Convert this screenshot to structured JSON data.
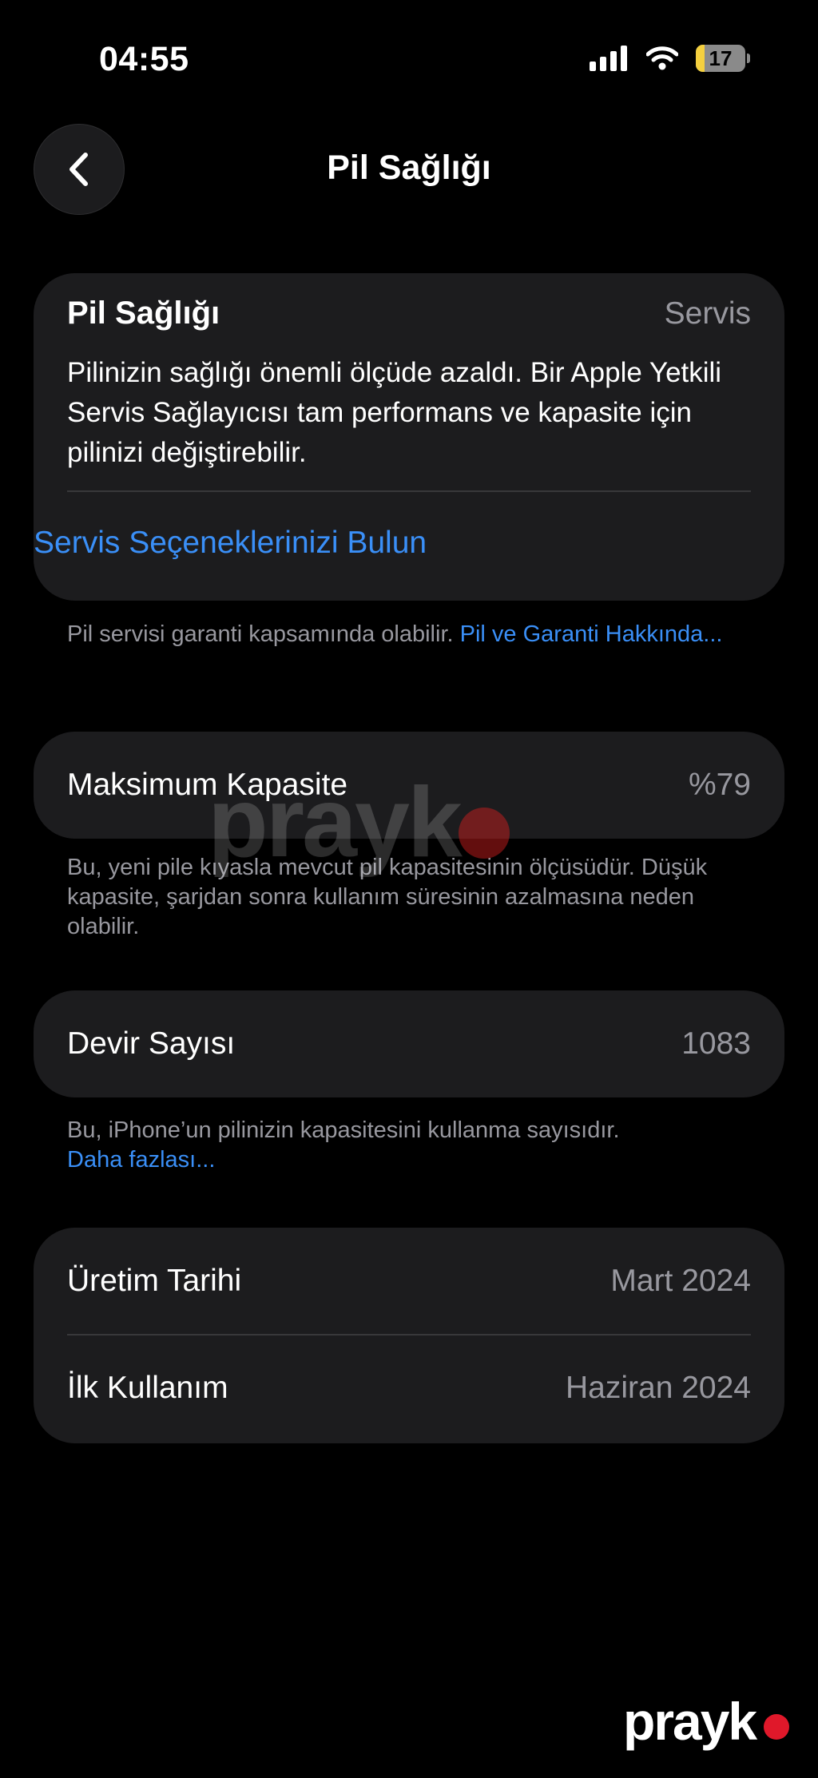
{
  "status_bar": {
    "time": "04:55",
    "battery_level": "17",
    "battery_color": "#f4d03f"
  },
  "nav": {
    "title": "Pil Sağlığı",
    "back_icon": "chevron-left-icon"
  },
  "battery_health": {
    "title": "Pil Sağlığı",
    "status": "Servis",
    "description": "Pilinizin sağlığı önemli ölçüde azaldı. Bir Apple Yetkili Servis Sağlayıcısı tam performans ve kapasite için pilinizi değiştirebilir.",
    "link": "Servis Seçeneklerinizi Bulun",
    "footnote_text": "Pil servisi garanti kapsamında olabilir. ",
    "footnote_link": "Pil ve Garanti Hakkında..."
  },
  "max_capacity": {
    "label": "Maksimum Kapasite",
    "value": "%79",
    "footnote": "Bu, yeni pile kıyasla mevcut pil kapasitesinin ölçüsüdür. Düşük kapasite, şarjdan sonra kullanım süresinin azalmasına neden olabilir."
  },
  "cycle_count": {
    "label": "Devir Sayısı",
    "value": "1083",
    "footnote_text": "Bu, iPhone’un pilinizin kapasitesini kullanma sayısıdır.",
    "footnote_link": "Daha fazlası..."
  },
  "dates": {
    "manufacture_label": "Üretim Tarihi",
    "manufacture_value": "Mart 2024",
    "first_use_label": "İlk Kullanım",
    "first_use_value": "Haziran 2024"
  },
  "watermark": {
    "text": "prayk"
  },
  "colors": {
    "background": "#000000",
    "card": "#1c1c1e",
    "link": "#3a8ff7",
    "secondary_text": "#98989f"
  }
}
